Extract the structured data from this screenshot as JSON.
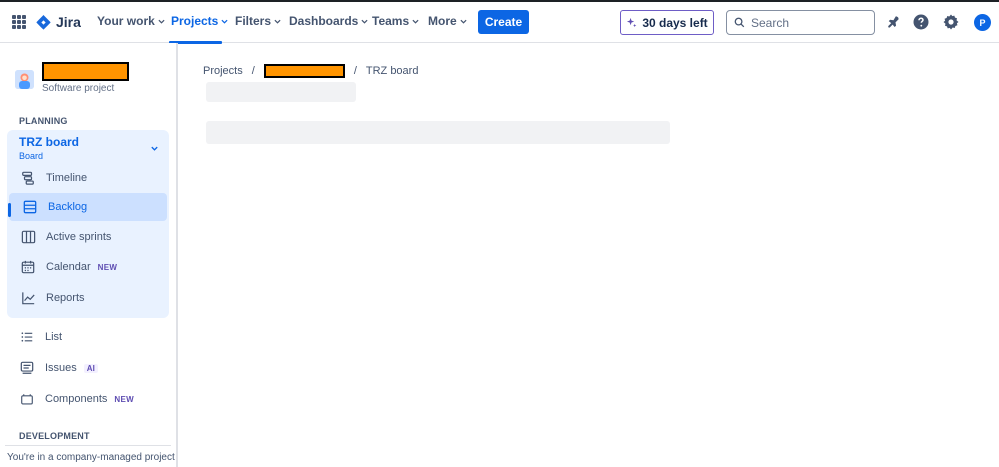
{
  "topnav": {
    "app_name": "Jira",
    "items": [
      {
        "label": "Your work"
      },
      {
        "label": "Projects"
      },
      {
        "label": "Filters"
      },
      {
        "label": "Dashboards"
      },
      {
        "label": "Teams"
      },
      {
        "label": "More"
      }
    ],
    "active_item": "Projects",
    "create_label": "Create",
    "trial_label": "30 days left",
    "search_placeholder": "Search",
    "avatar_initial": "P"
  },
  "colors": {
    "accent": "#0c66e4",
    "selected_bg": "#cce0ff",
    "group_bg": "#e9f2ff",
    "redaction": "#ff9400",
    "trial_border": "#6e5dc6"
  },
  "sidebar": {
    "project_type": "Software project",
    "planning_title": "PLANNING",
    "board": {
      "title": "TRZ board",
      "subtitle": "Board"
    },
    "planning_items": [
      {
        "label": "Timeline",
        "icon": "timeline-icon"
      },
      {
        "label": "Backlog",
        "icon": "backlog-icon",
        "selected": true
      },
      {
        "label": "Active sprints",
        "icon": "active-sprints-icon"
      },
      {
        "label": "Calendar",
        "icon": "calendar-icon",
        "badge": "NEW"
      },
      {
        "label": "Reports",
        "icon": "reports-icon"
      }
    ],
    "other_items": [
      {
        "label": "List",
        "icon": "list-icon"
      },
      {
        "label": "Issues",
        "icon": "issues-icon",
        "badge": "AI"
      },
      {
        "label": "Components",
        "icon": "components-icon",
        "badge": "NEW"
      }
    ],
    "development_title": "DEVELOPMENT",
    "footer_text": "You're in a company-managed project"
  },
  "main": {
    "breadcrumb": {
      "root": "Projects",
      "sep": "/",
      "current": "TRZ board"
    }
  }
}
